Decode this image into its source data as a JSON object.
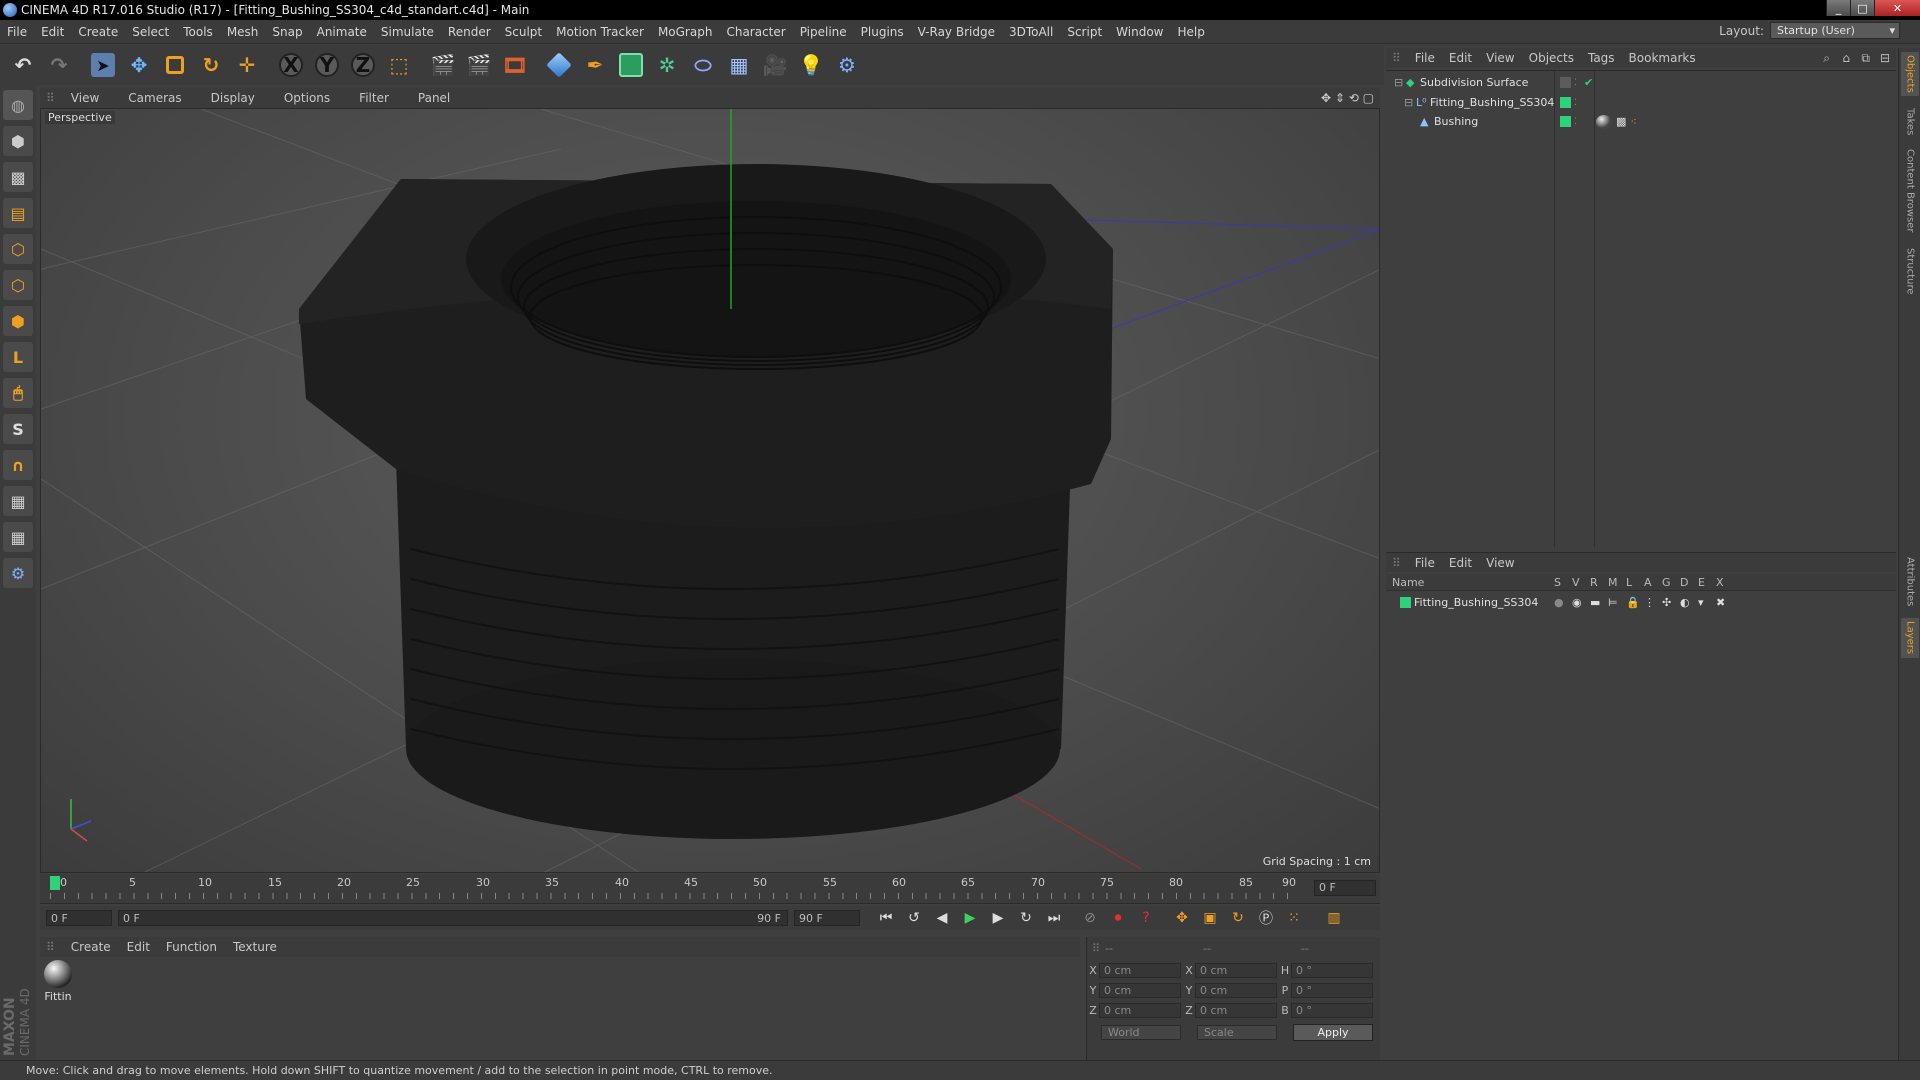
{
  "window": {
    "title": "CINEMA 4D R17.016 Studio (R17) - [Fitting_Bushing_SS304_c4d_standart.c4d] - Main",
    "controls": [
      "_",
      "□",
      "✕"
    ]
  },
  "menubar": {
    "items": [
      "File",
      "Edit",
      "Create",
      "Select",
      "Tools",
      "Mesh",
      "Snap",
      "Animate",
      "Simulate",
      "Render",
      "Sculpt",
      "Motion Tracker",
      "MoGraph",
      "Character",
      "Pipeline",
      "Plugins",
      "V-Ray Bridge",
      "3DToAll",
      "Script",
      "Window",
      "Help"
    ],
    "layout_label": "Layout:",
    "layout_value": "Startup (User)"
  },
  "toolbar": {
    "axis_labels": [
      "X",
      "Y",
      "Z"
    ]
  },
  "viewport": {
    "menu": [
      "View",
      "Cameras",
      "Display",
      "Options",
      "Filter",
      "Panel"
    ],
    "label": "Perspective",
    "grid_spacing": "Grid Spacing : 1 cm"
  },
  "timeline": {
    "ticks": [
      "0",
      "5",
      "10",
      "15",
      "20",
      "25",
      "30",
      "35",
      "40",
      "45",
      "50",
      "55",
      "60",
      "65",
      "70",
      "75",
      "80",
      "85",
      "90"
    ],
    "current_frame": "0 F"
  },
  "transport": {
    "start_field": "0 F",
    "range_start": "0 F",
    "range_end": "90 F",
    "end_field": "90 F"
  },
  "material_manager": {
    "menu": [
      "Create",
      "Edit",
      "Function",
      "Texture"
    ],
    "materials": [
      {
        "name": "Fittin"
      }
    ]
  },
  "coordinates": {
    "header": [
      "--",
      "--",
      "--"
    ],
    "rows": [
      {
        "a1": "X",
        "v1": "0 cm",
        "a2": "X",
        "v2": "0 cm",
        "a3": "H",
        "v3": "0 °"
      },
      {
        "a1": "Y",
        "v1": "0 cm",
        "a2": "Y",
        "v2": "0 cm",
        "a3": "P",
        "v3": "0 °"
      },
      {
        "a1": "Z",
        "v1": "0 cm",
        "a2": "Z",
        "v2": "0 cm",
        "a3": "B",
        "v3": "0 °"
      }
    ],
    "mode1": "World",
    "mode2": "Scale",
    "apply": "Apply"
  },
  "object_manager": {
    "menu": [
      "File",
      "Edit",
      "View",
      "Objects",
      "Tags",
      "Bookmarks"
    ],
    "objects": [
      {
        "name": "Subdivision Surface"
      },
      {
        "name": "Fitting_Bushing_SS304"
      },
      {
        "name": "Bushing"
      }
    ]
  },
  "layer_manager": {
    "menu": [
      "File",
      "Edit",
      "View"
    ],
    "columns": [
      "Name",
      "S",
      "V",
      "R",
      "M",
      "L",
      "A",
      "G",
      "D",
      "E",
      "X"
    ],
    "layers": [
      {
        "name": "Fitting_Bushing_SS304",
        "color": "#2fd17a"
      }
    ]
  },
  "right_tabs": [
    "Objects",
    "Takes",
    "Content Browser",
    "Structure",
    "Attributes",
    "Layers"
  ],
  "status": "Move: Click and drag to move elements. Hold down SHIFT to quantize movement / add to the selection in point mode, CTRL to remove.",
  "logo": {
    "brand": "MAXON",
    "product": "CINEMA 4D"
  },
  "colors": {
    "accent": "#f0a020",
    "selected_green": "#2fd17a",
    "viewport_bg": "#555555"
  }
}
